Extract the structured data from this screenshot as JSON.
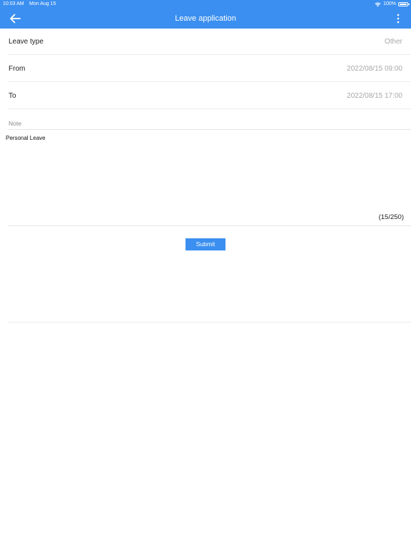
{
  "status_bar": {
    "time": "10:03 AM",
    "date": "Mon Aug 15",
    "battery": "100%"
  },
  "header": {
    "title": "Leave application",
    "back_icon": "arrow-left-icon",
    "more_icon": "more-vertical-icon"
  },
  "form": {
    "rows": [
      {
        "label": "Leave type",
        "value": "Other"
      },
      {
        "label": "From",
        "value": "2022/08/15 09:00"
      },
      {
        "label": "To",
        "value": "2022/08/15 17:00"
      }
    ],
    "note": {
      "label": "Note",
      "value": "Personal Leave",
      "counter": "(15/250)"
    },
    "submit_label": "Submit"
  },
  "colors": {
    "primary": "#3b8ff0",
    "muted_text": "#a8a8a8",
    "divider": "#ececec"
  }
}
